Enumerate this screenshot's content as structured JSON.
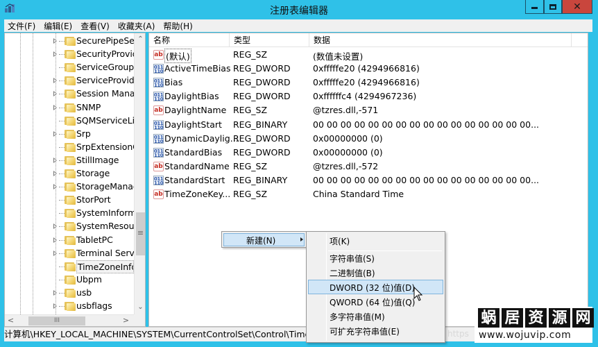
{
  "window": {
    "title": "注册表编辑器",
    "app_icon": "regedit-icon",
    "controls": {
      "minimize": "minimize-icon",
      "maximize": "maximize-icon",
      "close_glyph": "✕"
    }
  },
  "menubar": {
    "items": [
      {
        "label": "文件(F)"
      },
      {
        "label": "编辑(E)"
      },
      {
        "label": "查看(V)"
      },
      {
        "label": "收藏夹(A)"
      },
      {
        "label": "帮助(H)"
      }
    ]
  },
  "tree": {
    "items": [
      {
        "label": "SecurePipeServers",
        "display": "SecurePipeServ",
        "expandable": true
      },
      {
        "label": "SecurityProviders",
        "display": "SecurityProvide",
        "expandable": true
      },
      {
        "label": "ServiceGroupOrder",
        "display": "ServiceGroupO",
        "expandable": false
      },
      {
        "label": "ServiceProvider",
        "display": "ServiceProvider",
        "expandable": true
      },
      {
        "label": "Session Manager",
        "display": "Session Manag",
        "expandable": true
      },
      {
        "label": "SNMP",
        "display": "SNMP",
        "expandable": true
      },
      {
        "label": "SQMServiceList",
        "display": "SQMServiceList",
        "expandable": false
      },
      {
        "label": "Srp",
        "display": "Srp",
        "expandable": true
      },
      {
        "label": "SrpExtensionConfig",
        "display": "SrpExtensionCo",
        "expandable": false
      },
      {
        "label": "StillImage",
        "display": "StillImage",
        "expandable": true
      },
      {
        "label": "Storage",
        "display": "Storage",
        "expandable": true
      },
      {
        "label": "StorageManagement",
        "display": "StorageManag",
        "expandable": true
      },
      {
        "label": "StorPort",
        "display": "StorPort",
        "expandable": false
      },
      {
        "label": "SystemInformation",
        "display": "SystemInforma",
        "expandable": false
      },
      {
        "label": "SystemResources",
        "display": "SystemResourc",
        "expandable": true
      },
      {
        "label": "TabletPC",
        "display": "TabletPC",
        "expandable": true
      },
      {
        "label": "Terminal Server",
        "display": "Terminal Serve",
        "expandable": true
      },
      {
        "label": "TimeZoneInformation",
        "display": "TimeZoneInfor",
        "expandable": false,
        "selected": true
      },
      {
        "label": "Ubpm",
        "display": "Ubpm",
        "expandable": false
      },
      {
        "label": "usb",
        "display": "usb",
        "expandable": true
      },
      {
        "label": "usbflags",
        "display": "usbflags",
        "expandable": true
      }
    ],
    "scroll": {
      "up_glyph": "⌃",
      "down_glyph": "⌄",
      "left_glyph": "<",
      "right_glyph": ">",
      "thumb_grip_v": "≡",
      "thumb_grip_h": "III"
    }
  },
  "list": {
    "columns": {
      "name": "名称",
      "type": "类型",
      "data": "数据"
    },
    "rows": [
      {
        "name": "(默认)",
        "type": "REG_SZ",
        "data": "(数值未设置)",
        "icon": "ab",
        "default": true
      },
      {
        "name": "ActiveTimeBias",
        "type": "REG_DWORD",
        "data": "0xfffffe20 (4294966816)",
        "icon": "bin"
      },
      {
        "name": "Bias",
        "type": "REG_DWORD",
        "data": "0xfffffe20 (4294966816)",
        "icon": "bin"
      },
      {
        "name": "DaylightBias",
        "type": "REG_DWORD",
        "data": "0xffffffc4 (4294967236)",
        "icon": "bin"
      },
      {
        "name": "DaylightName",
        "type": "REG_SZ",
        "data": "@tzres.dll,-571",
        "icon": "ab"
      },
      {
        "name": "DaylightStart",
        "type": "REG_BINARY",
        "data": "00 00 00 00 00 00 00 00 00 00 00 00 00 00 00 00...",
        "icon": "bin"
      },
      {
        "name": "DynamicDaylig...",
        "type": "REG_DWORD",
        "data": "0x00000000 (0)",
        "icon": "bin"
      },
      {
        "name": "StandardBias",
        "type": "REG_DWORD",
        "data": "0x00000000 (0)",
        "icon": "bin"
      },
      {
        "name": "StandardName",
        "type": "REG_SZ",
        "data": "@tzres.dll,-572",
        "icon": "ab"
      },
      {
        "name": "StandardStart",
        "type": "REG_BINARY",
        "data": "00 00 00 00 00 00 00 00 00 00 00 00 00 00 00 00...",
        "icon": "bin"
      },
      {
        "name": "TimeZoneKey...",
        "type": "REG_SZ",
        "data": "China Standard Time",
        "icon": "ab"
      }
    ]
  },
  "context_menu": {
    "item": {
      "label": "新建(N)"
    },
    "submenu": [
      {
        "label": "项(K)"
      },
      {
        "separator": true
      },
      {
        "label": "字符串值(S)"
      },
      {
        "label": "二进制值(B)"
      },
      {
        "label": "DWORD (32 位)值(D)",
        "hover": true
      },
      {
        "label": "QWORD (64 位)值(Q)"
      },
      {
        "label": "多字符串值(M)"
      },
      {
        "label": "可扩充字符串值(E)"
      }
    ]
  },
  "statusbar": {
    "path": "计算机\\HKEY_LOCAL_MACHINE\\SYSTEM\\CurrentControlSet\\Control\\TimeZoneInformation"
  },
  "watermark": {
    "chars": [
      "蜗",
      "居",
      "资",
      "源",
      "网"
    ],
    "url": "www.wojuvip.com",
    "faint_text": "https"
  },
  "colors": {
    "titlebar": "#2fc1e8",
    "close_button": "#c9463d",
    "menu_highlight": "#d1e6f7",
    "menu_highlight_border": "#7fb4dd"
  }
}
